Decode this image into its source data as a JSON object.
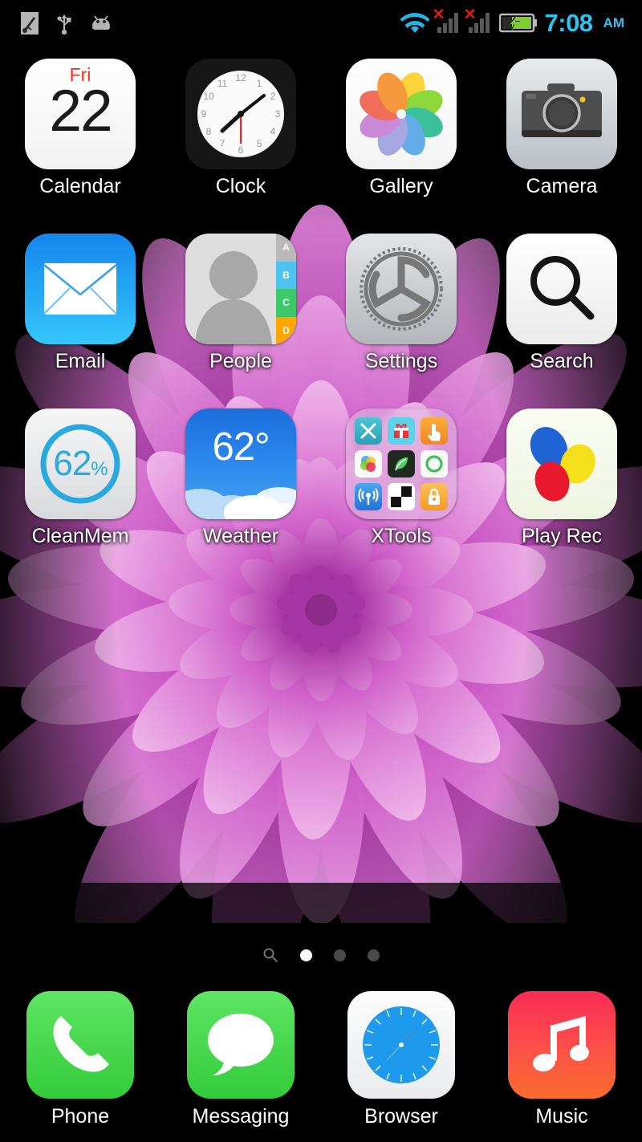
{
  "status_bar": {
    "left_icons": [
      {
        "name": "screenshot-icon",
        "label": "screenshot"
      },
      {
        "name": "usb-icon",
        "label": "usb"
      },
      {
        "name": "android-icon",
        "label": "android"
      }
    ],
    "wifi": "wifi-connected",
    "signal_1": "no-service",
    "signal_2": "no-service",
    "signal_x_mark": "✕",
    "battery": "charging",
    "time": "7:08",
    "ampm": "AM",
    "accent_color": "#2fc2ef",
    "alert_color": "#e01b14"
  },
  "home": {
    "rows": [
      [
        {
          "id": "calendar",
          "label": "Calendar",
          "icon": "calendar-icon",
          "dow": "Fri",
          "day": "22"
        },
        {
          "id": "clock",
          "label": "Clock",
          "icon": "clock-icon",
          "hour_marks": [
            "12",
            "1",
            "2",
            "3",
            "4",
            "5",
            "6",
            "7",
            "8",
            "9",
            "10",
            "11"
          ]
        },
        {
          "id": "gallery",
          "label": "Gallery",
          "icon": "gallery-icon"
        },
        {
          "id": "camera",
          "label": "Camera",
          "icon": "camera-icon"
        }
      ],
      [
        {
          "id": "email",
          "label": "Email",
          "icon": "email-icon"
        },
        {
          "id": "people",
          "label": "People",
          "icon": "people-icon",
          "tabs": [
            "A",
            "B",
            "C",
            "D"
          ],
          "tab_colors": [
            "#b9b9b9",
            "#4ec3f0",
            "#3cc86a",
            "#ffa500"
          ]
        },
        {
          "id": "settings",
          "label": "Settings",
          "icon": "settings-icon"
        },
        {
          "id": "search",
          "label": "Search",
          "icon": "search-icon"
        }
      ],
      [
        {
          "id": "cleanmem",
          "label": "CleanMem",
          "icon": "memory-gauge-icon",
          "value": "62",
          "unit": "%",
          "ring_color": "#28a9e0"
        },
        {
          "id": "weather",
          "label": "Weather",
          "icon": "weather-icon",
          "temperature": "62°"
        },
        {
          "id": "xtools",
          "label": "XTools",
          "icon": "folder-icon",
          "mini_apps": [
            {
              "name": "x-app-icon",
              "glyph": "X",
              "bg": "#38b8c9"
            },
            {
              "name": "gift-app-icon",
              "glyph": "",
              "bg": "#5cd3e8"
            },
            {
              "name": "tap-app-icon",
              "glyph": "",
              "bg": "#f6921e"
            },
            {
              "name": "colors-app-icon",
              "glyph": "",
              "bg": "#ffffff"
            },
            {
              "name": "green-app-icon",
              "glyph": "",
              "bg": "#1e2a20"
            },
            {
              "name": "ring-app-icon",
              "glyph": "",
              "bg": "#f7f7f7"
            },
            {
              "name": "signal-app-icon",
              "glyph": "",
              "bg": "#2d8fe8"
            },
            {
              "name": "checker-app-icon",
              "glyph": "",
              "bg": "#ffffff"
            },
            {
              "name": "lock-app-icon",
              "glyph": "",
              "bg": "#f7a233"
            }
          ]
        },
        {
          "id": "playrec",
          "label": "Play Rec",
          "icon": "play-rec-icon",
          "egg_colors": [
            "#1f63d4",
            "#f5e01b",
            "#e8192c"
          ]
        }
      ]
    ]
  },
  "pager": {
    "search_icon": "search-icon",
    "pages": 3,
    "active_page": 1
  },
  "dock": {
    "items": [
      {
        "id": "phone",
        "label": "Phone",
        "icon": "phone-icon"
      },
      {
        "id": "messaging",
        "label": "Messaging",
        "icon": "message-bubble-icon"
      },
      {
        "id": "browser",
        "label": "Browser",
        "icon": "compass-icon"
      },
      {
        "id": "music",
        "label": "Music",
        "icon": "music-note-icon"
      }
    ]
  },
  "wallpaper": {
    "name": "purple-dahlia-flower",
    "background_color": "#000000",
    "petal_colors": [
      "#c94fc4",
      "#b43fb0",
      "#d96fd2",
      "#8e2a8c",
      "#e08fdd"
    ]
  }
}
